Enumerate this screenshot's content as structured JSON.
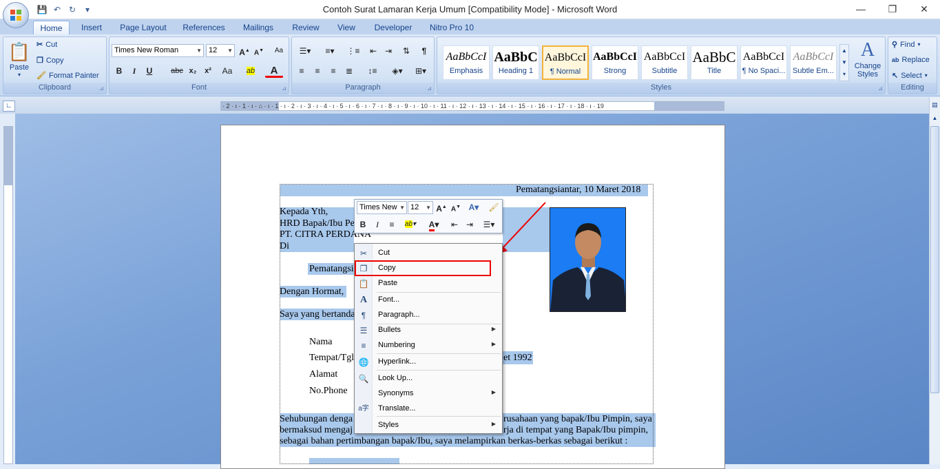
{
  "app": {
    "title": "Contoh Surat Lamaran Kerja Umum [Compatibility Mode] - Microsoft Word"
  },
  "window_controls": {
    "minimize": "—",
    "restore": "❐",
    "close": "✕"
  },
  "qat": {
    "save": "💾",
    "undo": "↶",
    "redo": "↻",
    "customize": "▾"
  },
  "tabs": [
    "Home",
    "Insert",
    "Page Layout",
    "References",
    "Mailings",
    "Review",
    "View",
    "Developer",
    "Nitro Pro 10"
  ],
  "clipboard": {
    "paste": "Paste",
    "cut": "Cut",
    "copy": "Copy",
    "format_painter": "Format Painter",
    "label": "Clipboard"
  },
  "font": {
    "name": "Times New Roman",
    "size": "12",
    "label": "Font",
    "bold": "B",
    "italic": "I",
    "underline": "U",
    "strike": "abc",
    "sub": "x₂",
    "sup": "x²",
    "case": "Aa"
  },
  "paragraph": {
    "label": "Paragraph"
  },
  "styles": {
    "label": "Styles",
    "items": [
      {
        "preview": "AaBbCcI",
        "name": "Emphasis"
      },
      {
        "preview": "AaBbC",
        "name": "Heading 1"
      },
      {
        "preview": "AaBbCcI",
        "name": "¶ Normal"
      },
      {
        "preview": "AaBbCcI",
        "name": "Strong"
      },
      {
        "preview": "AaBbCcI",
        "name": "Subtitle"
      },
      {
        "preview": "AaBbC",
        "name": "Title"
      },
      {
        "preview": "AaBbCcI",
        "name": "¶ No Spaci..."
      },
      {
        "preview": "AaBbCcI",
        "name": "Subtle Em..."
      }
    ],
    "change_styles": "Change Styles"
  },
  "editing": {
    "label": "Editing",
    "find": "Find",
    "replace": "Replace",
    "select": "Select"
  },
  "ruler": {
    "marks": "· 2 · ı · 1 · ı · ⌂ · ı · 1 · ı · 2 · ı · 3 · ı · 4 · ı · 5 · ı · 6 · ı · 7 · ı · 8 · ı · 9 · ı · 10 · ı · 11 · ı · 12 · ı · 13 · ı · 14 · ı · 15 · ı · 16 · ı · 17 · ı · 18 · ı · 19"
  },
  "document": {
    "date_line": "Pematangsiantar, 10 Maret 2018",
    "to1": "Kepada Yth,",
    "to2": "HRD Bapak/Ibu Pe",
    "to3": "PT. CITRA PERDANA",
    "to4": "Di",
    "city": "Pematangsi",
    "greeting": "Dengan Hormat,",
    "intro": "Saya yang bertanda",
    "f_nama": "Nama",
    "f_ttl": "Tempat/Tgl",
    "f_ttl_val": "et 1992",
    "f_alamat": "Alamat",
    "f_phone": "No.Phone",
    "p1a": "Sehubungan denga",
    "p1a_r": "rusahaan yang bapak/Ibu Pimpin, saya",
    "p1b": "bermaksud mengaj",
    "p1b_r": "rja di tempat yang Bapak/Ibu pimpin,",
    "p1c": "sebagai bahan pertimbangan bapak/Ibu, saya melampirkan berkas-berkas sebagai berikut :"
  },
  "mini_toolbar": {
    "font": "Times New",
    "size": "12"
  },
  "context_menu": {
    "items": [
      {
        "label": "Cut",
        "icon": "scissors-icon",
        "glyph": "✂"
      },
      {
        "label": "Copy",
        "icon": "copy-icon",
        "glyph": "❐"
      },
      {
        "label": "Paste",
        "icon": "paste-icon",
        "glyph": "📋"
      },
      {
        "label": "Font...",
        "icon": "font-icon",
        "glyph": "A"
      },
      {
        "label": "Paragraph...",
        "icon": "paragraph-icon",
        "glyph": "¶"
      },
      {
        "label": "Bullets",
        "icon": "bullets-icon",
        "glyph": "☰"
      },
      {
        "label": "Numbering",
        "icon": "numbering-icon",
        "glyph": "≡"
      },
      {
        "label": "Hyperlink...",
        "icon": "hyperlink-icon",
        "glyph": "🌐"
      },
      {
        "label": "Look Up...",
        "icon": "lookup-icon",
        "glyph": "🔍"
      },
      {
        "label": "Synonyms",
        "icon": "synonyms-icon",
        "glyph": ""
      },
      {
        "label": "Translate...",
        "icon": "translate-icon",
        "glyph": "a字"
      },
      {
        "label": "Styles",
        "icon": "styles-icon",
        "glyph": ""
      }
    ],
    "highlighted": "Copy"
  },
  "colors": {
    "accent": "#15428b",
    "selection": "#a8c8ec",
    "highlight_box": "#e00000",
    "style_selected": "#f4b23b"
  }
}
